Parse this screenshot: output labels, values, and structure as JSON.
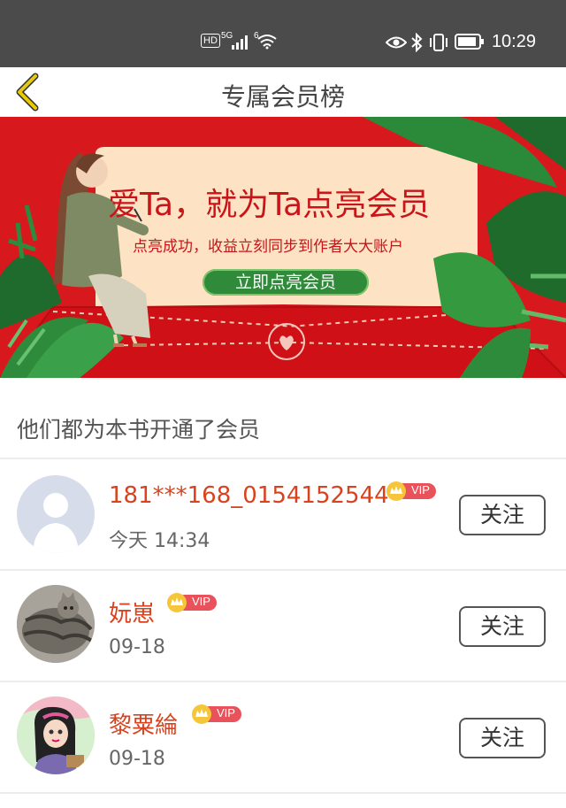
{
  "status_bar": {
    "hd": "HD",
    "signal_5g": "5G",
    "wifi_6": "6",
    "time": "10:29",
    "icons": [
      "eye-icon",
      "bluetooth-icon",
      "vibrate-icon",
      "battery-icon",
      "signal-icon",
      "wifi-icon"
    ]
  },
  "header": {
    "title": "专属会员榜",
    "back_icon": "chevron-left-icon",
    "back_color": "#d9b800"
  },
  "banner": {
    "headline": "爱Ta，就为Ta点亮会员",
    "subline": "点亮成功，收益立刻同步到作者大大账户",
    "button_label": "立即点亮会员",
    "background": "#d7191d",
    "card_color": "#fde3c3",
    "button_color": "#2f8a3a"
  },
  "list": {
    "heading": "他们都为本书开通了会员",
    "vip_label": "VIP",
    "follow_label": "关注",
    "items": [
      {
        "name": "181***168_0154152544",
        "date": "今天 14:34",
        "avatar": "default-avatar"
      },
      {
        "name": "妧崽",
        "date": "09-18",
        "avatar": "cat-avatar"
      },
      {
        "name": "黎粟綸",
        "date": "09-18",
        "avatar": "cartoon-girl-avatar"
      }
    ]
  }
}
